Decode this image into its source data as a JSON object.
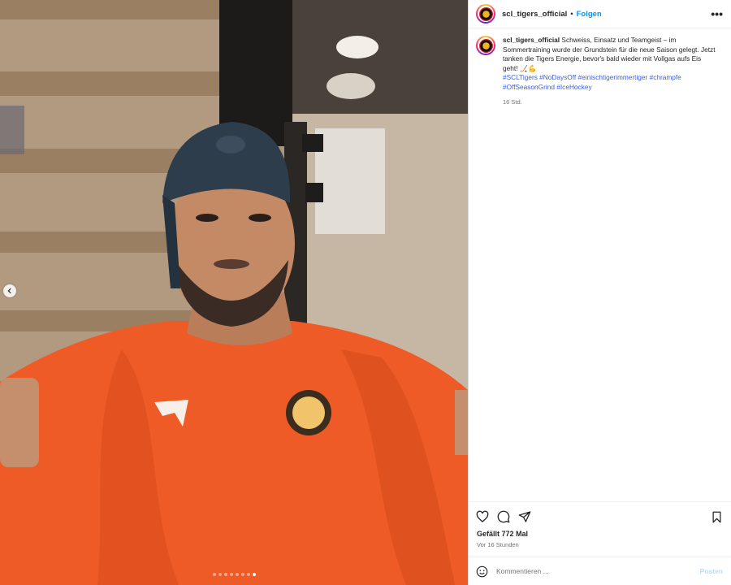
{
  "post": {
    "username": "scl_tigers_official",
    "separator": "•",
    "follow_label": "Folgen",
    "more_label": "•••",
    "caption_text": "Schweiss, Einsatz und Teamgeist – im Sommertraining wurde der Grundstein für die neue Saison gelegt. Jetzt tanken die Tigers Energie, bevor's bald wieder mit Vollgas aufs Eis geht! 🏒💪",
    "hashtags": "#SCLTigers #NoDaysOff #einischtigerimmertiger #chrampfe #OffSeasonGrind #IceHockey",
    "caption_time": "16 Std.",
    "likes": "Gefällt 772 Mal",
    "ago": "Vor 16 Stunden",
    "comment_placeholder": "Kommentieren ...",
    "post_label": "Posten"
  },
  "media": {
    "carousel_dots": 8,
    "active_dot": 7
  },
  "icons": {
    "heart": "heart-icon",
    "comment": "comment-icon",
    "share": "share-icon",
    "save": "bookmark-icon",
    "emoji": "emoji-icon",
    "prev": "chevron-left-icon"
  },
  "colors": {
    "follow": "#0095f6",
    "hashtag": "#3b5fd9",
    "shirt": "#f0602a",
    "post_disabled": "#b2dffc"
  }
}
